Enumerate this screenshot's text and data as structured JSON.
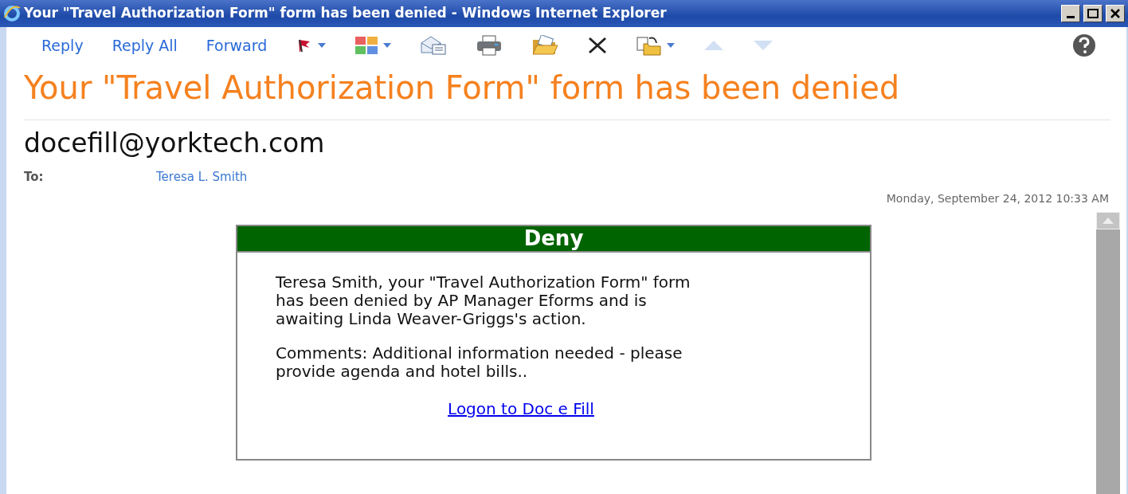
{
  "window": {
    "title": "Your \"Travel Authorization Form\" form has been denied - Windows Internet Explorer"
  },
  "toolbar": {
    "actions": [
      "Reply",
      "Reply All",
      "Forward"
    ],
    "icons": [
      {
        "kind": "flag",
        "dropdown": true,
        "disabled": false
      },
      {
        "kind": "categories",
        "dropdown": true,
        "disabled": false
      },
      {
        "kind": "envelope",
        "dropdown": false,
        "disabled": false
      },
      {
        "kind": "printer",
        "dropdown": false,
        "disabled": false
      },
      {
        "kind": "folder",
        "dropdown": false,
        "disabled": false
      },
      {
        "kind": "delete",
        "dropdown": false,
        "disabled": false
      },
      {
        "kind": "move",
        "dropdown": true,
        "disabled": false
      },
      {
        "kind": "up",
        "dropdown": false,
        "disabled": true
      },
      {
        "kind": "down",
        "dropdown": false,
        "disabled": true
      }
    ]
  },
  "message": {
    "subject": "Your \"Travel Authorization Form\" form has been denied",
    "from": "docefill@yorktech.com",
    "to_label": "To:",
    "to": "Teresa L. Smith",
    "date": "Monday, September 24, 2012 10:33 AM"
  },
  "notice": {
    "heading": "Deny",
    "paragraphs": [
      "Teresa Smith, your \"Travel Authorization Form\" form has been denied by AP Manager Eforms and is awaiting Linda Weaver-Griggs's action.",
      "Comments: Additional information needed - please provide agenda and hotel bills.."
    ],
    "link": "Logon to Doc e Fill"
  }
}
